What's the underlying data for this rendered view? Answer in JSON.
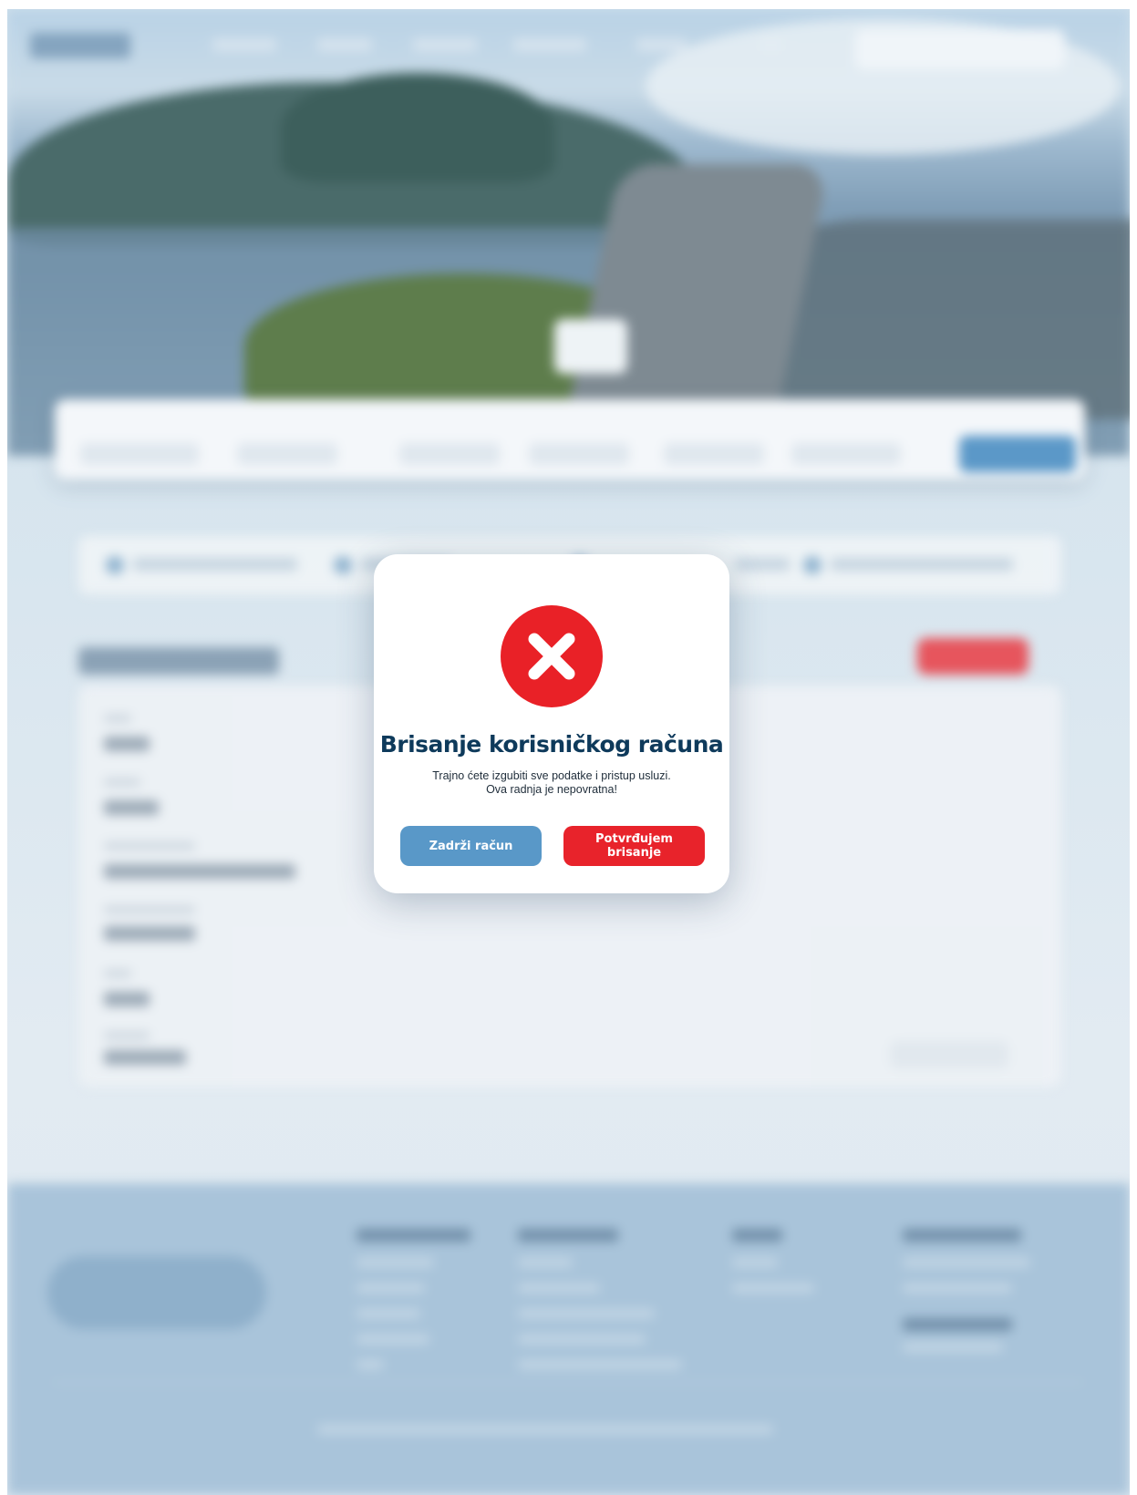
{
  "modal": {
    "icon": "close-icon",
    "title": "Brisanje korisničkog računa",
    "message_line1": "Trajno ćete izgubiti sve podatke i pristup usluzi.",
    "message_line2": "Ova radnja je nepovratna!",
    "keep_button": "Zadrži račun",
    "confirm_button": "Potvrđujem brisanje"
  },
  "colors": {
    "danger": "#e92127",
    "primary": "#5998c8",
    "title": "#0e3a5b"
  }
}
